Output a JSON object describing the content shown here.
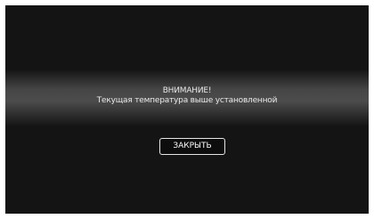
{
  "dialog": {
    "title": "ВНИМАНИЕ!",
    "message": "Текущая температура выше установленной",
    "close_label": "ЗАКРЫТЬ"
  },
  "colors": {
    "screen_background": "#141414",
    "text": "#e8e8e8",
    "button_border": "#e6e6e6"
  }
}
